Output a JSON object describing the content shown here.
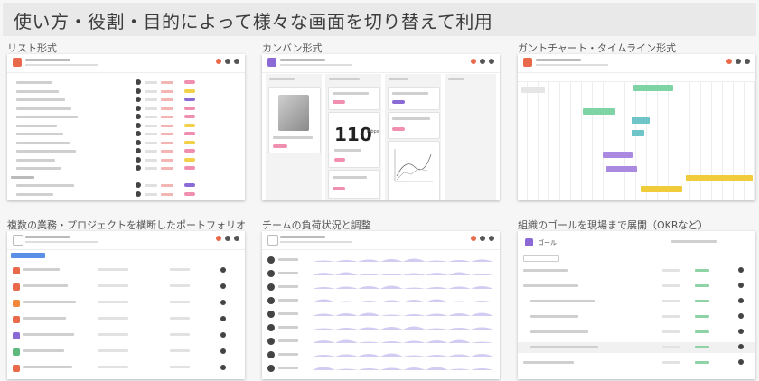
{
  "banner": {
    "title": "使い方・役割・目的によって様々な画面を切り替えて利用"
  },
  "panels": [
    {
      "caption": "リスト形式"
    },
    {
      "caption": "カンバン形式"
    },
    {
      "caption": "ガントチャート・タイムライン形式"
    },
    {
      "caption": "複数の業務・プロジェクトを横断したポートフォリオ"
    },
    {
      "caption": "チームの負荷状況と調整"
    },
    {
      "caption": "組織のゴールを現場まで展開（OKRなど）"
    }
  ],
  "kanban": {
    "big_number": "110",
    "big_unit": "Mbps"
  },
  "goals": {
    "header_label": "ゴール"
  },
  "colors": {
    "accent_red": "#e86a4a",
    "accent_purple": "#8b6ad6",
    "pill_pink": "#f08fb0",
    "pill_yellow": "#f2d04a",
    "gantt_green": "#7fd4a6",
    "gantt_purple": "#a98ae0",
    "gantt_yellow": "#f0cc3a",
    "load_wave": "#c9c3ef"
  }
}
